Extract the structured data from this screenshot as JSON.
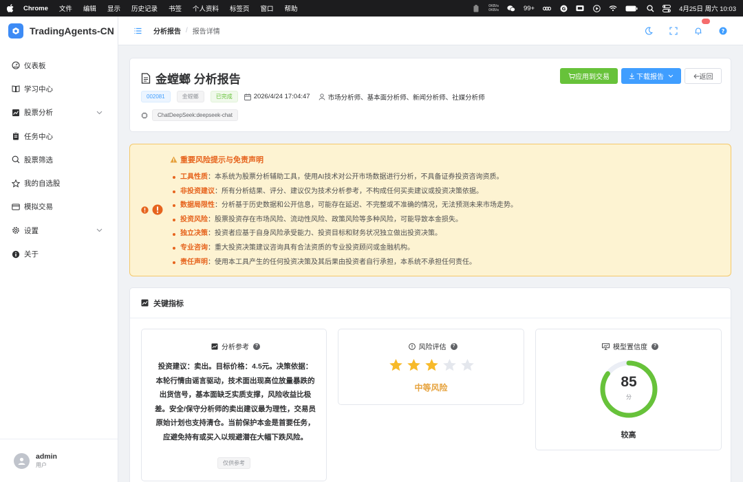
{
  "menubar": {
    "app": "Chrome",
    "items": [
      "文件",
      "编辑",
      "显示",
      "历史记录",
      "书签",
      "个人资料",
      "标签页",
      "窗口",
      "帮助"
    ],
    "net_up": "0KB/s",
    "net_down": "0KB/s",
    "badge": "99+",
    "datetime": "4月25日 周六  10:03"
  },
  "sidebar": {
    "brand": "TradingAgents-CN",
    "items": [
      {
        "label": "仪表板",
        "icon": "dashboard-icon"
      },
      {
        "label": "学习中心",
        "icon": "book-icon"
      },
      {
        "label": "股票分析",
        "icon": "chart-icon",
        "expandable": true
      },
      {
        "label": "任务中心",
        "icon": "clipboard-icon"
      },
      {
        "label": "股票筛选",
        "icon": "search-icon"
      },
      {
        "label": "我的自选股",
        "icon": "star-icon"
      },
      {
        "label": "模拟交易",
        "icon": "card-icon"
      },
      {
        "label": "设置",
        "icon": "gear-icon",
        "expandable": true
      },
      {
        "label": "关于",
        "icon": "info-icon"
      }
    ],
    "user": {
      "name": "admin",
      "role": "用户"
    }
  },
  "header": {
    "breadcrumb_parent": "分析报告",
    "breadcrumb_sep": "/",
    "breadcrumb_current": "报告详情"
  },
  "report": {
    "title": "金螳螂 分析报告",
    "code": "002081",
    "name": "金螳螂",
    "status": "已完成",
    "datetime": "2026/4/24 17:04:47",
    "analysts": "市场分析师、基本面分析师、新闻分析师、社媒分析师",
    "model": "ChatDeepSeek:deepseek-chat",
    "btn_apply": "应用到交易",
    "btn_download": "下载报告",
    "btn_back": "返回"
  },
  "risk_notice": {
    "title": "重要风险提示与免责声明",
    "items": [
      {
        "key": "工具性质",
        "text": "：本系统为股票分析辅助工具，使用AI技术对公开市场数据进行分析，不具备证券投资咨询资质。"
      },
      {
        "key": "非投资建议",
        "text": "：所有分析结果、评分、建议仅为技术分析参考，不构成任何买卖建议或投资决策依据。"
      },
      {
        "key": "数据局限性",
        "text": "：分析基于历史数据和公开信息，可能存在延迟、不完整或不准确的情况，无法预测未来市场走势。"
      },
      {
        "key": "投资风险",
        "text": "：股票投资存在市场风险、流动性风险、政策风险等多种风险，可能导致本金损失。"
      },
      {
        "key": "独立决策",
        "text": "：投资者应基于自身风险承受能力、投资目标和财务状况独立做出投资决策。"
      },
      {
        "key": "专业咨询",
        "text": "：重大投资决策建议咨询具有合法资质的专业投资顾问或金融机构。"
      },
      {
        "key": "责任声明",
        "text": "：使用本工具产生的任何投资决策及其后果由投资者自行承担，本系统不承担任何责任。"
      }
    ]
  },
  "metrics": {
    "title": "关键指标",
    "analysis": {
      "title": "分析参考",
      "text": "投资建议：卖出。目标价格：4.5元。决策依据：本轮行情由谣言驱动，技术面出现高位放量暴跌的出货信号，基本面缺乏实质支撑，风险收益比极差。安全/保守分析师的卖出建议最为理性，交易员原始计划也支持清仓。当前保护本金是首要任务，应避免持有或买入以规避潜在大幅下跌风险。",
      "tag": "仅供参考"
    },
    "risk": {
      "title": "风险评估",
      "stars": 3,
      "stars_max": 5,
      "level": "中等风险"
    },
    "confidence": {
      "title": "模型置信度",
      "score": "85",
      "score_value": 85,
      "unit": "分",
      "level": "较高",
      "color": "#67c23a"
    }
  }
}
